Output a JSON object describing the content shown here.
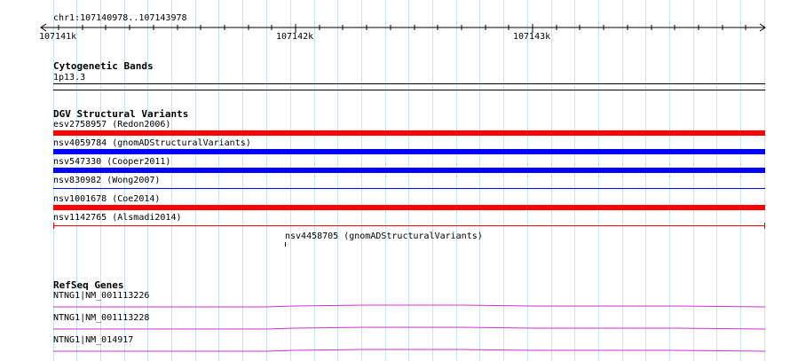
{
  "location": "chr1:107140978..107143978",
  "ruler": {
    "labels": [
      "107141k",
      "107142k",
      "107143k"
    ]
  },
  "cytoband": {
    "title": "Cytogenetic Bands",
    "band": "1p13.3"
  },
  "dgv": {
    "title": "DGV Structural Variants",
    "variants": [
      {
        "label": "esv2758957 (Redon2006)",
        "color": "#ff0000"
      },
      {
        "label": "nsv4059784 (gnomADStructuralVariants)",
        "color": "#0000ff"
      },
      {
        "label": "nsv547330 (Cooper2011)",
        "color": "#0000ff"
      },
      {
        "label": "nsv830982 (Wong2007)",
        "color": "#0000ff"
      },
      {
        "label": "nsv1001678 (Coe2014)",
        "color": "#ff0000"
      },
      {
        "label": "nsv1142765 (Alsmadi2014)",
        "color": "#ff0000"
      },
      {
        "label": "nsv4458705 (gnomADStructuralVariants)",
        "color": "#000000"
      }
    ]
  },
  "refseq": {
    "title": "RefSeq Genes",
    "genes": [
      {
        "label": "NTNG1|NM_001113226",
        "color": "#cc33cc"
      },
      {
        "label": "NTNG1|NM_001113228",
        "color": "#cc33cc"
      },
      {
        "label": "NTNG1|NM_014917",
        "color": "#cc33cc"
      }
    ]
  },
  "colors": {
    "grid": "#c6e6ef",
    "gain": "#ff0000",
    "loss": "#0000ff",
    "gene": "#cc33cc"
  }
}
